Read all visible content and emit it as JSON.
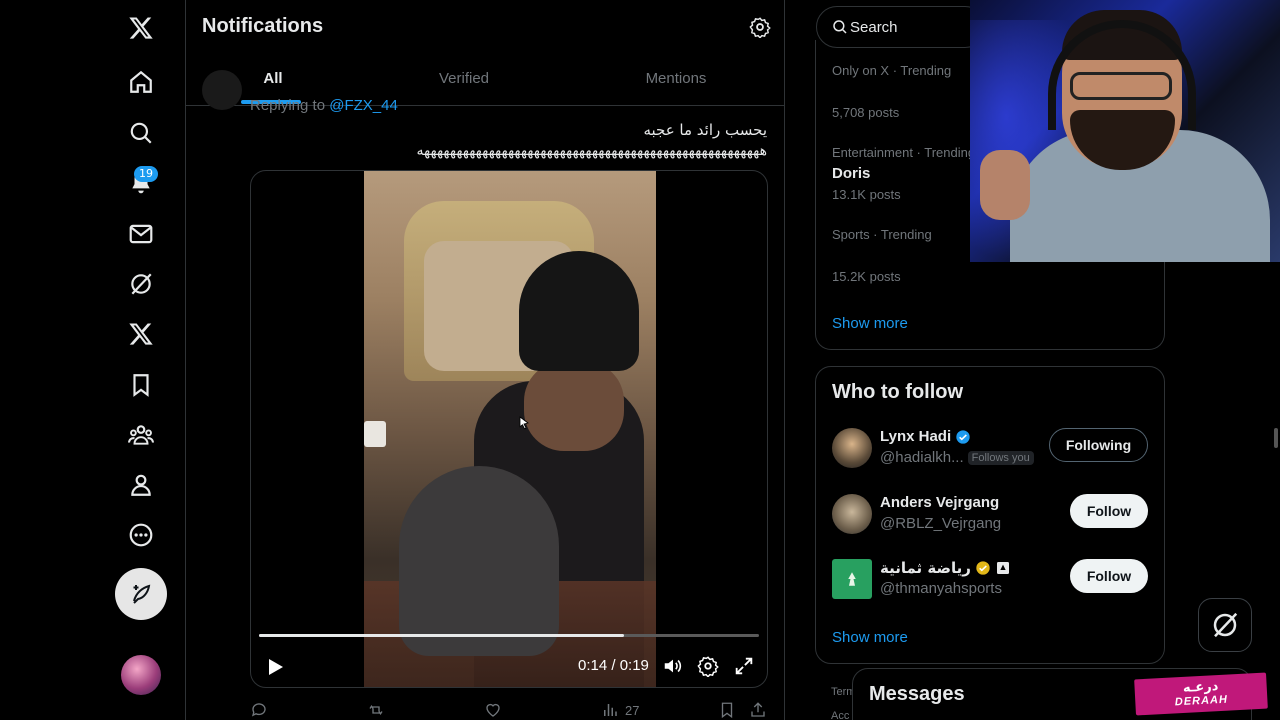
{
  "nav": {
    "badge_count": "19",
    "icons": [
      "x-logo-icon",
      "home-icon",
      "search-icon",
      "notifications-icon",
      "messages-icon",
      "grok-icon",
      "premium-x-icon",
      "bookmarks-icon",
      "communities-icon",
      "profile-icon",
      "more-icon",
      "post-icon"
    ]
  },
  "header": {
    "title": "Notifications"
  },
  "tabs": [
    {
      "label": "All",
      "active": true
    },
    {
      "label": "Verified",
      "active": false
    },
    {
      "label": "Mentions",
      "active": false
    }
  ],
  "tweet": {
    "replying_prefix": "Replying to ",
    "replying_handle": "@FZX_44",
    "text_line1": "يحسب رائد ما عجبه",
    "text_line2": "هههههههههههههههههههههههههههههههههههههههههههههههههههههه",
    "video": {
      "time": "0:14 / 0:19",
      "progress": 0.73
    },
    "views": "27"
  },
  "search": {
    "placeholder": "Search"
  },
  "trends": [
    {
      "meta": "Only on X · Trending",
      "title": "",
      "posts": "5,708 posts"
    },
    {
      "meta": "Entertainment · Trending",
      "title": "Doris",
      "posts": "13.1K posts"
    },
    {
      "meta": "Sports · Trending",
      "title": "",
      "posts": "15.2K posts"
    }
  ],
  "trends_show_more": "Show more",
  "who_to_follow": {
    "title": "Who to follow",
    "people": [
      {
        "name": "Lynx Hadi",
        "handle": "@hadialkh...",
        "follows_you": "Follows you",
        "button": "Following"
      },
      {
        "name": "Anders Vejrgang",
        "handle": "@RBLZ_Vejrgang",
        "follows_you": "",
        "button": "Follow"
      },
      {
        "name": "رياضة ثمانية",
        "handle": "@thmanyahsports",
        "follows_you": "",
        "button": "Follow"
      }
    ],
    "show_more": "Show more"
  },
  "messages": {
    "title": "Messages"
  },
  "footer": {
    "terms": "Term",
    "acc": "Acc"
  },
  "overlay_logo": {
    "arabic": "درعـه",
    "english": "DERAAH"
  },
  "colors": {
    "accent": "#1d9bf0",
    "background": "#000000",
    "border": "#2f3336",
    "muted": "#71767b"
  }
}
